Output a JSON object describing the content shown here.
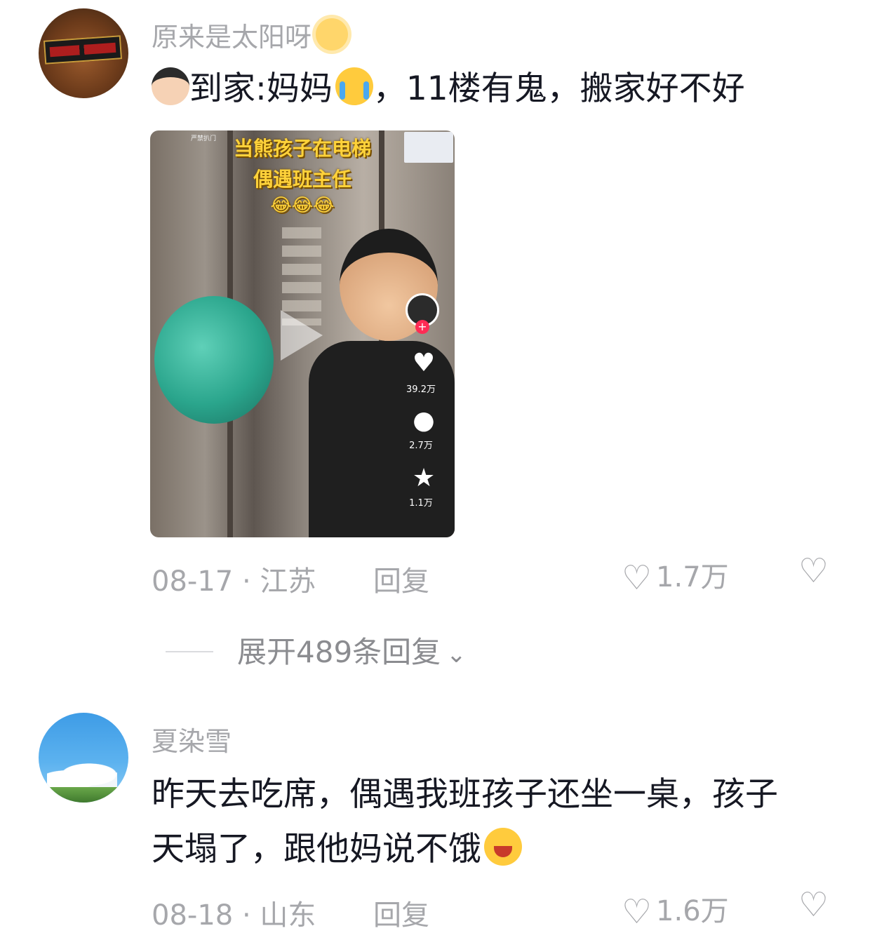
{
  "comments": [
    {
      "username": "原来是太阳呀",
      "text_part1": "到家:妈妈",
      "text_part2": "，11楼有鬼，搬家好不好",
      "video": {
        "caption_line1": "当熊孩子在电梯",
        "caption_line2": "偶遇班主任",
        "caption_line3": "😂😂😂",
        "likes": "39.2万",
        "comments": "2.7万",
        "favorites": "1.1万",
        "tag": "严禁扒门"
      },
      "date": "08-17",
      "location": "江苏",
      "reply_label": "回复",
      "like_count": "1.7万"
    },
    {
      "username": "夏染雪",
      "text_line1": "昨天去吃席，偶遇我班孩子还坐一桌，孩子",
      "text_line2": "天塌了，跟他妈说不饿",
      "date": "08-18",
      "location": "山东",
      "reply_label": "回复",
      "like_count": "1.6万"
    }
  ],
  "expand_replies": "展开489条回复",
  "icons": {
    "like": "heart-outline-icon",
    "dislike": "broken-heart-icon",
    "chevron": "chevron-down-icon"
  },
  "colors": {
    "text": "#161823",
    "muted": "#a6a7ab",
    "accent": "#fe2c55",
    "caption": "#ffd23a"
  }
}
